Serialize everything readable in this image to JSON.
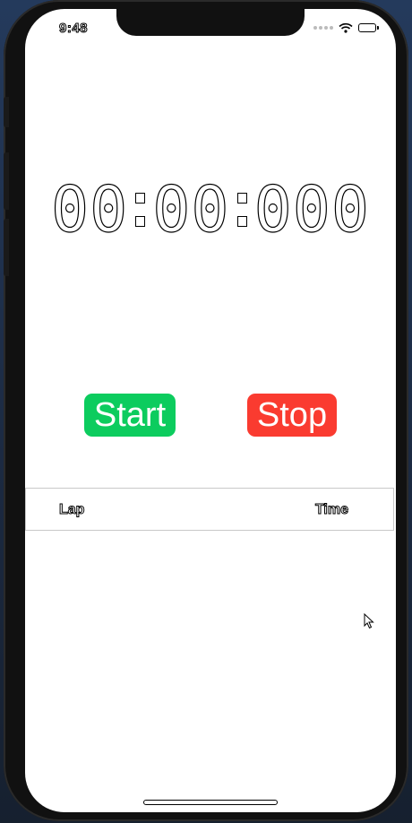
{
  "status_bar": {
    "time": "9:48",
    "icons": [
      "cellular-signal-icon",
      "wifi-icon",
      "battery-icon"
    ]
  },
  "stopwatch": {
    "minutes": "00",
    "seconds": "00",
    "milliseconds": "000"
  },
  "controls": {
    "start_label": "Start",
    "stop_label": "Stop",
    "start_color": "#0ccc5e",
    "stop_color": "#fa3b30"
  },
  "laps_table": {
    "columns": [
      "Lap",
      "Time"
    ],
    "rows": []
  }
}
